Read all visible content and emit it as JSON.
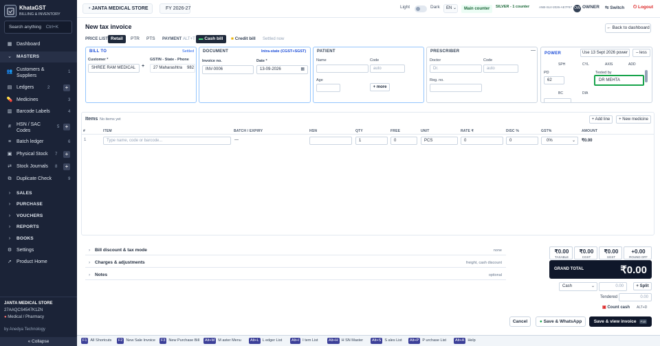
{
  "sidebar": {
    "brand_name": "KhataGST",
    "brand_sub": "BILLING & INVENTORY",
    "search_placeholder": "Search anything",
    "search_shortcut": "Ctrl+K",
    "items": {
      "dashboard": {
        "label": "Dashboard"
      },
      "masters": {
        "label": "MASTERS"
      },
      "customers": {
        "label1": "Customers &",
        "label2": "Suppliers",
        "count": "1"
      },
      "ledgers": {
        "label": "Ledgers",
        "count": "2",
        "add": "+"
      },
      "medicines": {
        "label": "Medicines",
        "count": "3"
      },
      "barcode": {
        "label": "Barcode Labels",
        "count": "4"
      },
      "hsn": {
        "label1": "HSN / SAC",
        "label2": "Codes",
        "count": "5",
        "add": "+"
      },
      "batch": {
        "label": "Batch ledger",
        "count": "6"
      },
      "physical": {
        "label": "Physical Stock",
        "count": "7",
        "add": "+"
      },
      "stockj": {
        "label": "Stock Journals",
        "count": "8",
        "add": "+"
      },
      "dup": {
        "label": "Duplicate Check",
        "count": "9"
      },
      "sales": {
        "label": "SALES"
      },
      "purchase": {
        "label": "PURCHASE"
      },
      "vouchers": {
        "label": "VOUCHERS"
      },
      "reports": {
        "label": "REPORTS"
      },
      "books": {
        "label": "BOOKS"
      },
      "settings": {
        "label": "Settings"
      },
      "home": {
        "label": "Product Home"
      }
    },
    "footer": {
      "company": "JANTA MEDICAL STORE",
      "gstin": "27AAQCS4547K1ZN",
      "type": "Medical / Pharmacy",
      "by": "by Anedya Technology",
      "collapse": "« Collapse"
    }
  },
  "topbar": {
    "company": "JANTA MEDICAL STORE",
    "fy": "FY 2026-27",
    "light": "Light",
    "dark": "Dark",
    "lang": "EN",
    "counter": "Main counter",
    "plan": "SILVER - 1 counter",
    "plan_id": "ANB-SLV-2026-AE7F97",
    "avatar": "OW",
    "role": "OWNER",
    "switch": "Switch",
    "logout": "Logout"
  },
  "page": {
    "title": "New tax invoice",
    "back": "Back to dashboard",
    "price_list_label": "PRICE LIST",
    "price_tabs": [
      "Retail",
      "PTR",
      "PTS"
    ],
    "payment_label": "PAYMENT",
    "payment_shortcut": "ALT+T",
    "pay_cash": "Cash bill",
    "pay_credit": "Credit bill",
    "settled": "Settled now"
  },
  "bill_to": {
    "title": "BILL TO",
    "settled": "Settled",
    "customer_label": "Customer *",
    "customer": "SHREE RAM MEDICAL",
    "gstin_label": "GSTIN - State - Phone",
    "state": "27 Maharashtra",
    "phone": "982"
  },
  "document": {
    "title": "DOCUMENT",
    "type": "Intra-state (CGST+SGST)",
    "invoice_label": "Invoice no.",
    "invoice": "INV-0006",
    "date_label": "Date *",
    "date": "13-09-2026"
  },
  "patient": {
    "title": "PATIENT",
    "name_label": "Name",
    "code_label": "Code",
    "code_ph": "auto",
    "age_label": "Age",
    "more": "+ more"
  },
  "prescriber": {
    "title": "PRESCRIBER",
    "doctor_label": "Doctor",
    "doctor_ph": "Dr.",
    "code_label": "Code",
    "code_ph": "auto",
    "reg_label": "Reg. no."
  },
  "power": {
    "title": "POWER",
    "use_btn": "Use 13 Sept 2026 power",
    "less": "– less",
    "cols": [
      "SPH",
      "CYL",
      "AXIS",
      "ADD"
    ],
    "pd_label": "PD",
    "pd": "62",
    "tested_label": "Tested by",
    "tested": "DR MEHTA",
    "bc": "BC",
    "dia": "DIA"
  },
  "items": {
    "title": "Items",
    "empty": "No items yet",
    "add_line": "+ Add line",
    "new_med": "+ New medicine",
    "headers": [
      "#",
      "ITEM",
      "BATCH / EXPIRY",
      "HSN",
      "QTY",
      "FREE",
      "UNIT",
      "RATE ₹",
      "DISC %",
      "GST%",
      "AMOUNT"
    ],
    "row": {
      "num": "1",
      "item_ph": "Type name, code or barcode...",
      "batch": "—",
      "qty": "1",
      "free": "0",
      "unit": "PCS",
      "rate": "0",
      "disc": "0",
      "gst": "0%",
      "amount": "₹0.00"
    }
  },
  "sections": [
    {
      "title": "Bill discount & tax mode",
      "hint": "none"
    },
    {
      "title": "Charges & adjustments",
      "hint": "freight, cash discount"
    },
    {
      "title": "Notes",
      "hint": "optional"
    }
  ],
  "totals": {
    "taxable": {
      "value": "₹0.00",
      "label": "TAXABLE"
    },
    "cgst": {
      "value": "₹0.00",
      "label": "CGST"
    },
    "sgst": {
      "value": "₹0.00",
      "label": "SGST"
    },
    "round": {
      "value": "+0.00",
      "label": "ROUND OFF"
    },
    "grand_label": "GRAND TOTAL",
    "grand": "₹0.00",
    "mode": "Cash",
    "mode_amt": "0.00",
    "split": "+ Split",
    "tendered_label": "Tendered",
    "tendered": "0.00",
    "count_cash": "Count cash",
    "count_key": "ALT+D"
  },
  "footer_actions": {
    "cancel": "Cancel",
    "whatsapp": "Save & WhatsApp",
    "save_view": "Save & view invoice",
    "save_key": "F10"
  },
  "shortcuts": [
    {
      "key": "F1",
      "label": "All Shortcuts"
    },
    {
      "key": "F2",
      "label": "New Sale Invoice"
    },
    {
      "key": "F3",
      "label": "New Purchase Bill"
    },
    {
      "key": "Alt+M",
      "label": "M aster Menu"
    },
    {
      "key": "Alt+L",
      "label": "L edger List"
    },
    {
      "key": "Alt+I",
      "label": "I tem List"
    },
    {
      "key": "Alt+H",
      "label": "H SN Master"
    },
    {
      "key": "Alt+S",
      "label": "S ales List"
    },
    {
      "key": "Alt+P",
      "label": "P urchase List"
    },
    {
      "key": "Alt+A",
      "label": "Help"
    }
  ],
  "colors": {
    "sidebar": "#1b2337",
    "accent": "#0f172a",
    "green": "#16a34a",
    "link": "#1d4ed8"
  }
}
